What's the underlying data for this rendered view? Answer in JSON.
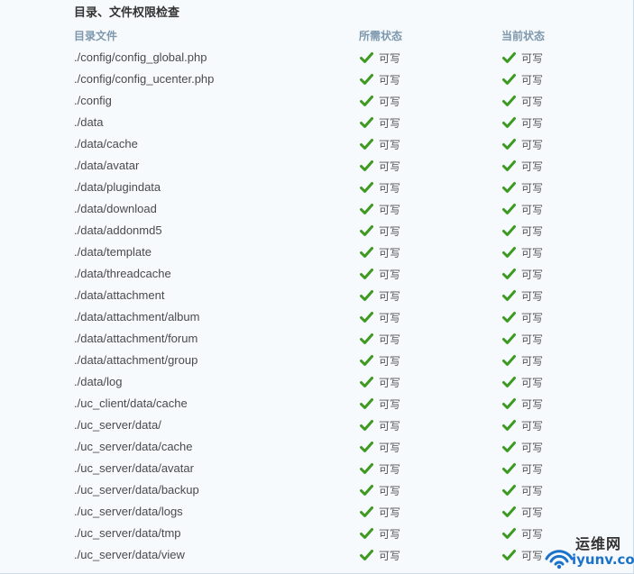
{
  "section_title": "目录、文件权限检查",
  "columns": {
    "path": "目录文件",
    "required": "所需状态",
    "current": "当前状态"
  },
  "colors": {
    "header": "#7d98ad",
    "check": "#3c9a1e",
    "watermark_blue": "#1a73c8"
  },
  "rows": [
    {
      "path": "./config/config_global.php",
      "required": "可写",
      "current": "可写"
    },
    {
      "path": "./config/config_ucenter.php",
      "required": "可写",
      "current": "可写"
    },
    {
      "path": "./config",
      "required": "可写",
      "current": "可写"
    },
    {
      "path": "./data",
      "required": "可写",
      "current": "可写"
    },
    {
      "path": "./data/cache",
      "required": "可写",
      "current": "可写"
    },
    {
      "path": "./data/avatar",
      "required": "可写",
      "current": "可写"
    },
    {
      "path": "./data/plugindata",
      "required": "可写",
      "current": "可写"
    },
    {
      "path": "./data/download",
      "required": "可写",
      "current": "可写"
    },
    {
      "path": "./data/addonmd5",
      "required": "可写",
      "current": "可写"
    },
    {
      "path": "./data/template",
      "required": "可写",
      "current": "可写"
    },
    {
      "path": "./data/threadcache",
      "required": "可写",
      "current": "可写"
    },
    {
      "path": "./data/attachment",
      "required": "可写",
      "current": "可写"
    },
    {
      "path": "./data/attachment/album",
      "required": "可写",
      "current": "可写"
    },
    {
      "path": "./data/attachment/forum",
      "required": "可写",
      "current": "可写"
    },
    {
      "path": "./data/attachment/group",
      "required": "可写",
      "current": "可写"
    },
    {
      "path": "./data/log",
      "required": "可写",
      "current": "可写"
    },
    {
      "path": "./uc_client/data/cache",
      "required": "可写",
      "current": "可写"
    },
    {
      "path": "./uc_server/data/",
      "required": "可写",
      "current": "可写"
    },
    {
      "path": "./uc_server/data/cache",
      "required": "可写",
      "current": "可写"
    },
    {
      "path": "./uc_server/data/avatar",
      "required": "可写",
      "current": "可写"
    },
    {
      "path": "./uc_server/data/backup",
      "required": "可写",
      "current": "可写"
    },
    {
      "path": "./uc_server/data/logs",
      "required": "可写",
      "current": "可写"
    },
    {
      "path": "./uc_server/data/tmp",
      "required": "可写",
      "current": "可写"
    },
    {
      "path": "./uc_server/data/view",
      "required": "可写",
      "current": "可写"
    }
  ],
  "icons": {
    "status": "check-icon",
    "watermark_logo": "wifi-logo-icon"
  },
  "watermark": {
    "top": "运维网",
    "bottom": "iyunv.com"
  }
}
